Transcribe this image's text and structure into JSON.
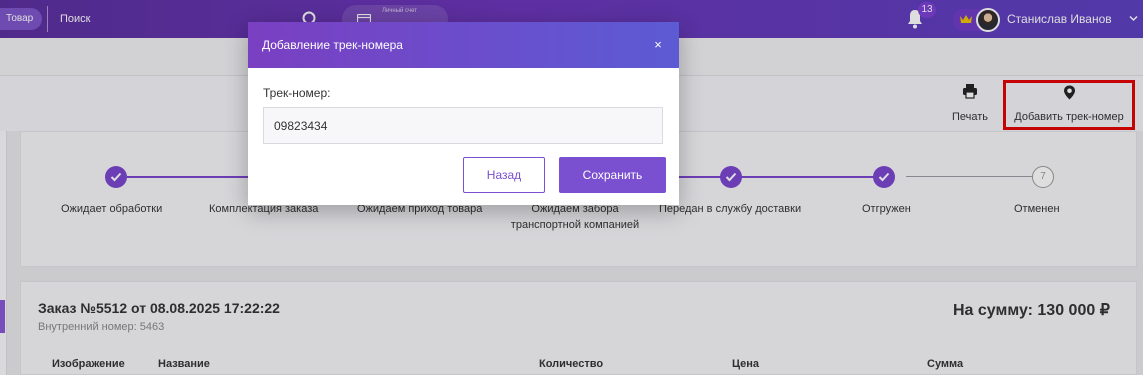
{
  "header": {
    "scope_label": "Товар",
    "search_placeholder": "Поиск",
    "account_label": "Личный счет",
    "notifications_count": "13",
    "user_name": "Станислав Иванов"
  },
  "actions": {
    "print_label": "Печать",
    "add_track_label": "Добавить трек-номер"
  },
  "status_steps": [
    {
      "label": "Ожидает обработки",
      "done": true
    },
    {
      "label": "Комплектация заказа",
      "done": true
    },
    {
      "label": "Ожидаем приход товара",
      "done": true
    },
    {
      "label_lines": [
        "Ожидаем забора",
        "транспортной компанией"
      ],
      "done": true
    },
    {
      "label": "Передан в службу доставки",
      "done": true
    },
    {
      "label": "Отгружен",
      "done": true
    },
    {
      "label": "Отменен",
      "done": false,
      "number": "7"
    }
  ],
  "order": {
    "title": "Заказ №5512 от 08.08.2025 17:22:22",
    "internal_number": "Внутренний номер: 5463",
    "total": "На сумму: 130 000 ₽",
    "columns": [
      "Изображение",
      "Название",
      "Количество",
      "Цена",
      "Сумма"
    ]
  },
  "modal": {
    "title": "Добавление трек-номера",
    "close_glyph": "×",
    "field_label": "Трек-номер:",
    "field_value": "09823434",
    "back_label": "Назад",
    "save_label": "Сохранить"
  },
  "colors": {
    "accent": "#7b45d0",
    "header": "#5a2e9e",
    "highlight_border": "#e20000"
  },
  "icons": [
    "search-icon",
    "wallet-icon",
    "bell-icon",
    "crown-icon",
    "chevron-down-icon",
    "printer-icon",
    "map-pin-icon",
    "check-icon",
    "close-icon"
  ]
}
